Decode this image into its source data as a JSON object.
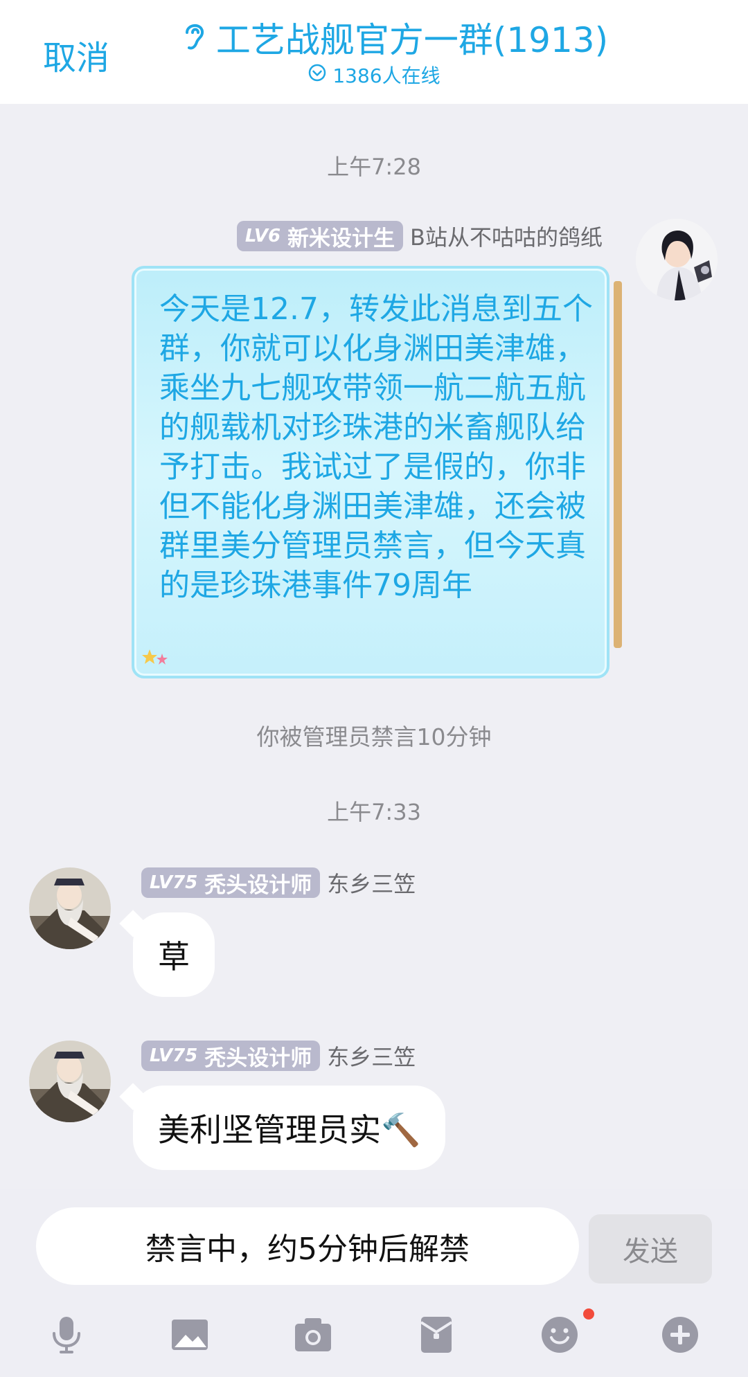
{
  "header": {
    "cancel_label": "取消",
    "title": "工艺战舰官方一群(1913)",
    "online": "1386人在线"
  },
  "messages": {
    "time1": "上午7:28",
    "msg1": {
      "level": "LV6",
      "rank": "新米设计生",
      "nick": "B站从不咕咕的鸽纸",
      "text": "今天是12.7，转发此消息到五个群，你就可以化身渊田美津雄，乘坐九七舰攻带领一航二航五航的舰载机对珍珠港的米畜舰队给予打击。我试过了是假的，你非但不能化身渊田美津雄，还会被群里美分管理员禁言，但今天真的是珍珠港事件79周年"
    },
    "system": "你被管理员禁言10分钟",
    "time2": "上午7:33",
    "msg2": {
      "level": "LV75",
      "rank": "秃头设计师",
      "nick": "东乡三笠",
      "text": "草"
    },
    "msg3": {
      "level": "LV75",
      "rank": "秃头设计师",
      "nick": "东乡三笠",
      "text": "美利坚管理员实🔨"
    }
  },
  "input": {
    "muted_text": "禁言中，约5分钟后解禁",
    "send_label": "发送"
  },
  "toolbar": [
    "mic-icon",
    "image-icon",
    "camera-icon",
    "red-packet-icon",
    "emoji-icon",
    "plus-icon"
  ],
  "colors": {
    "accent": "#1ea7e4",
    "badge": "#b9b9cd",
    "background": "#efeff4",
    "notification": "#f24b3b"
  }
}
